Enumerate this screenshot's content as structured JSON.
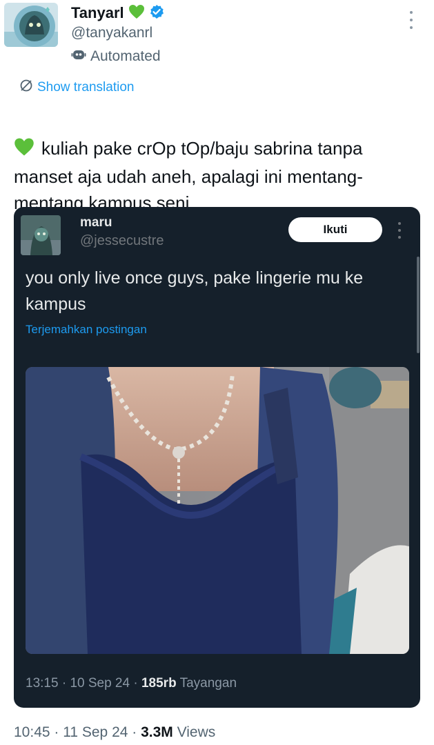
{
  "author": {
    "name": "Tanyarl",
    "handle": "@tanyakanrl",
    "automated_label": "Automated",
    "verified": true
  },
  "translate_link": "Show translation",
  "tweet": {
    "text": "kuliah pake crOp tOp/baju sabrina tanpa manset aja udah aneh, apalagi ini mentang-mentang kampus seni"
  },
  "quoted": {
    "name": "maru",
    "handle": "@jessecustre",
    "follow_label": "Ikuti",
    "text": "you only live once guys, pake lingerie mu ke kampus",
    "translate_label": "Terjemahkan postingan",
    "time": "13:15",
    "date": "10 Sep 24",
    "views_count": "185rb",
    "views_label": "Tayangan"
  },
  "meta": {
    "time": "10:45",
    "date": "11 Sep 24",
    "views_count": "3.3M",
    "views_label": "Views"
  },
  "colors": {
    "accent": "#1d9bf0",
    "heart": "#5bbf3a",
    "card_bg": "#15202b"
  }
}
